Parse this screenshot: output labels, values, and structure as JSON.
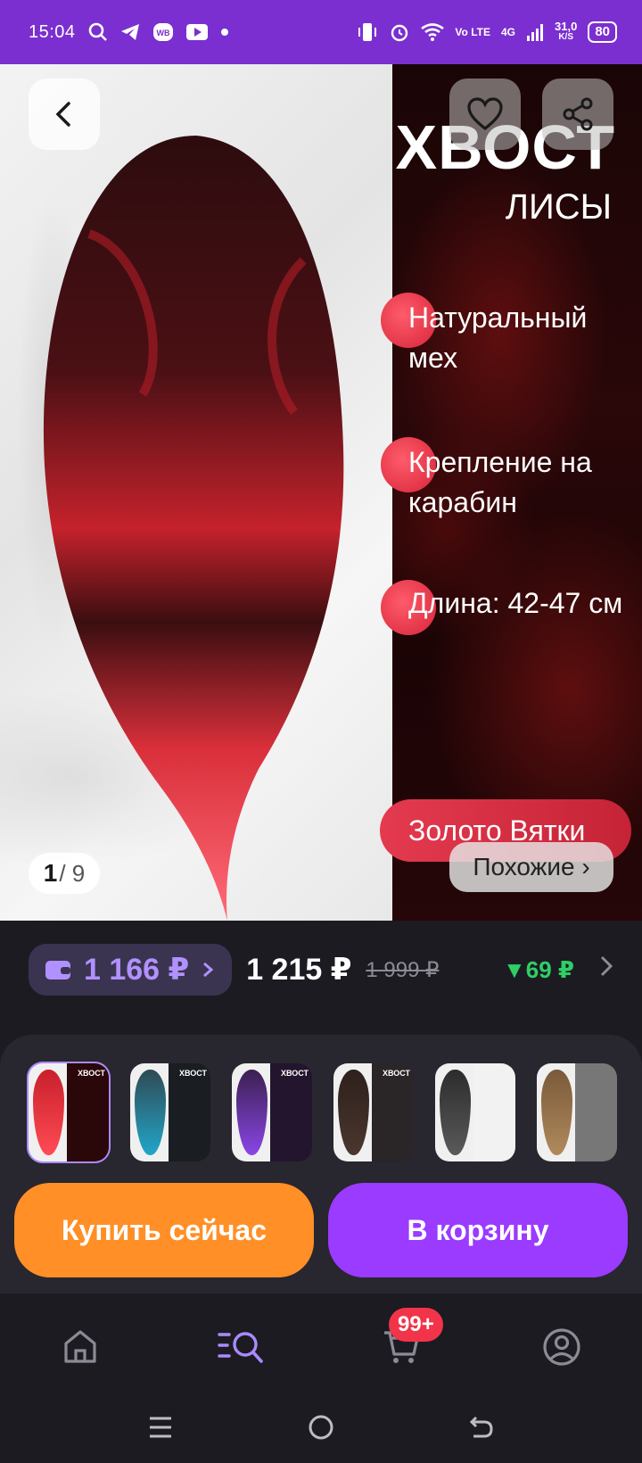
{
  "status_bar": {
    "time": "15:04",
    "volte": "Vo LTE",
    "network": "4G",
    "speed_value": "31,0",
    "speed_unit": "K/S",
    "battery": "80"
  },
  "product_image": {
    "title": "ХВОСТ",
    "subtitle": "ЛИСЫ",
    "features": [
      "Натуральный мех",
      "Крепление на карабин",
      "Длина: 42-47 см"
    ],
    "brand": "Золото Вятки",
    "counter_current": "1",
    "counter_total": "/ 9",
    "similar_label": "Похожие ›"
  },
  "price": {
    "wallet_price": "1 166 ₽",
    "current": "1 215 ₽",
    "old": "1 999 ₽",
    "drop": "▼69 ₽"
  },
  "variants": {
    "thumb_title": "ХВОСТ",
    "items": [
      {
        "fur": "#c8202b",
        "tip": "#ff4b55",
        "bg": "#2a0709",
        "selected": true
      },
      {
        "fur": "#2f4a55",
        "tip": "#22a6c9",
        "bg": "#1a1d22",
        "selected": false
      },
      {
        "fur": "#3b2050",
        "tip": "#8a46e6",
        "bg": "#24152e",
        "selected": false
      },
      {
        "fur": "#2e201c",
        "tip": "#4a372f",
        "bg": "#2a2526",
        "selected": false
      },
      {
        "fur": "#2c2c2c",
        "tip": "#5a5a5a",
        "bg": "#f2f2f2",
        "selected": false
      },
      {
        "fur": "#7a5a3a",
        "tip": "#b08a5c",
        "bg": "#777777",
        "selected": false
      }
    ]
  },
  "actions": {
    "buy_now": "Купить сейчас",
    "add_to_cart": "В корзину"
  },
  "bottom_nav": {
    "cart_badge": "99+",
    "items": [
      "home-icon",
      "catalog-search-icon",
      "cart-icon",
      "profile-icon"
    ],
    "active_color": "#a98bff"
  },
  "colors": {
    "status_bar": "#7b2fd0",
    "buy_now": "#ff8f26",
    "cart": "#9a3bff",
    "accent": "#b191ff",
    "price_drop": "#2fce66"
  }
}
